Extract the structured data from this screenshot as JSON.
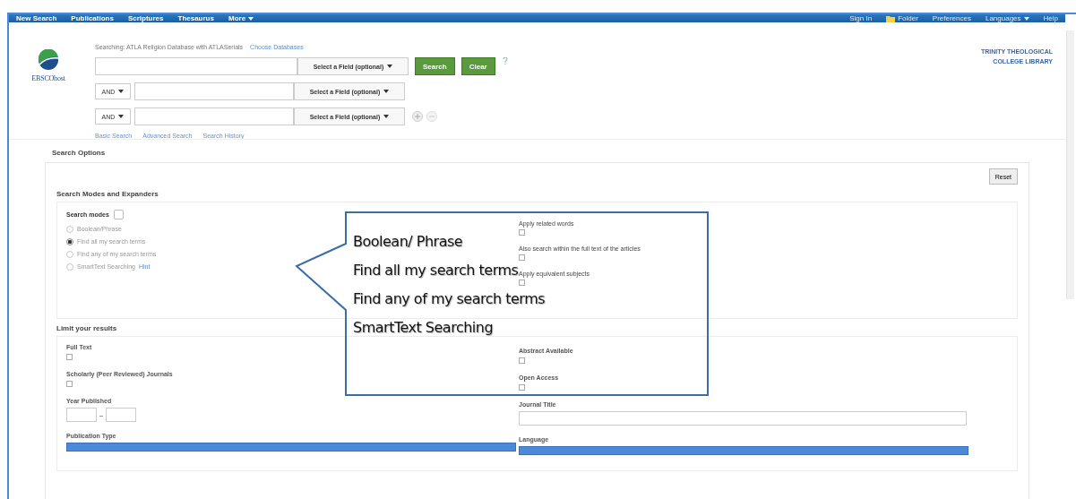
{
  "top_nav": {
    "left": [
      {
        "label": "New Search",
        "dropdown": false
      },
      {
        "label": "Publications",
        "dropdown": false
      },
      {
        "label": "Scriptures",
        "dropdown": false
      },
      {
        "label": "Thesaurus",
        "dropdown": false
      },
      {
        "label": "More",
        "dropdown": true
      }
    ],
    "right": [
      {
        "label": "Sign In",
        "kind": "link"
      },
      {
        "label": "Folder",
        "kind": "folder"
      },
      {
        "label": "Preferences",
        "kind": "link"
      },
      {
        "label": "Languages",
        "kind": "dropdown"
      },
      {
        "label": "Help",
        "kind": "link"
      }
    ]
  },
  "search": {
    "searching_label": "Searching: ATLA Religion Database with ATLASerials",
    "choose_link": "Choose Databases",
    "rows": [
      {
        "operator": "",
        "field": "Select a Field (optional)",
        "buttons": [
          "Search",
          "Clear"
        ],
        "help": true,
        "add_remove": false
      },
      {
        "operator": "AND",
        "field": "Select a Field (optional)",
        "buttons": [],
        "help": false,
        "add_remove": false
      },
      {
        "operator": "AND",
        "field": "Select a Field (optional)",
        "buttons": [],
        "help": false,
        "add_remove": true
      }
    ],
    "links": [
      "Basic Search",
      "Advanced Search",
      "Search History"
    ]
  },
  "logo_text": "EBSCOhost",
  "library_name": "TRINITY THEOLOGICAL COLLEGE LIBRARY",
  "search_options": {
    "title": "Search Options",
    "reset": "Reset",
    "modes_panel": {
      "title": "Search Modes and Expanders",
      "modes_label": "Search modes",
      "modes": [
        {
          "label": "Boolean/Phrase",
          "selected": false
        },
        {
          "label": "Find all my search terms",
          "selected": true
        },
        {
          "label": "Find any of my search terms",
          "selected": false
        },
        {
          "label": "SmartText Searching",
          "selected": false,
          "hint": "Hint"
        }
      ],
      "expanders": [
        {
          "label": "Apply related words",
          "checked": false
        },
        {
          "label": "Also search within the full text of the articles",
          "checked": false
        },
        {
          "label": "Apply equivalent subjects",
          "checked": false
        }
      ]
    },
    "limits_panel": {
      "title": "Limit your results",
      "left": [
        {
          "kind": "checkbox",
          "label": "Full Text",
          "checked": false
        },
        {
          "kind": "checkbox",
          "label": "Scholarly (Peer Reviewed) Journals",
          "checked": false
        },
        {
          "kind": "year",
          "label": "Year Published",
          "separator": "–"
        },
        {
          "kind": "select",
          "label": "Publication Type"
        }
      ],
      "right": [
        {
          "kind": "checkbox",
          "label": "Abstract Available",
          "checked": false
        },
        {
          "kind": "checkbox",
          "label": "Open Access",
          "checked": false
        },
        {
          "kind": "text",
          "label": "Journal Title"
        },
        {
          "kind": "select",
          "label": "Language"
        }
      ]
    }
  },
  "callout": {
    "lines": [
      "Boolean/ Phrase",
      "Find all my search terms",
      "Find any of my search terms",
      "SmartText Searching"
    ]
  }
}
